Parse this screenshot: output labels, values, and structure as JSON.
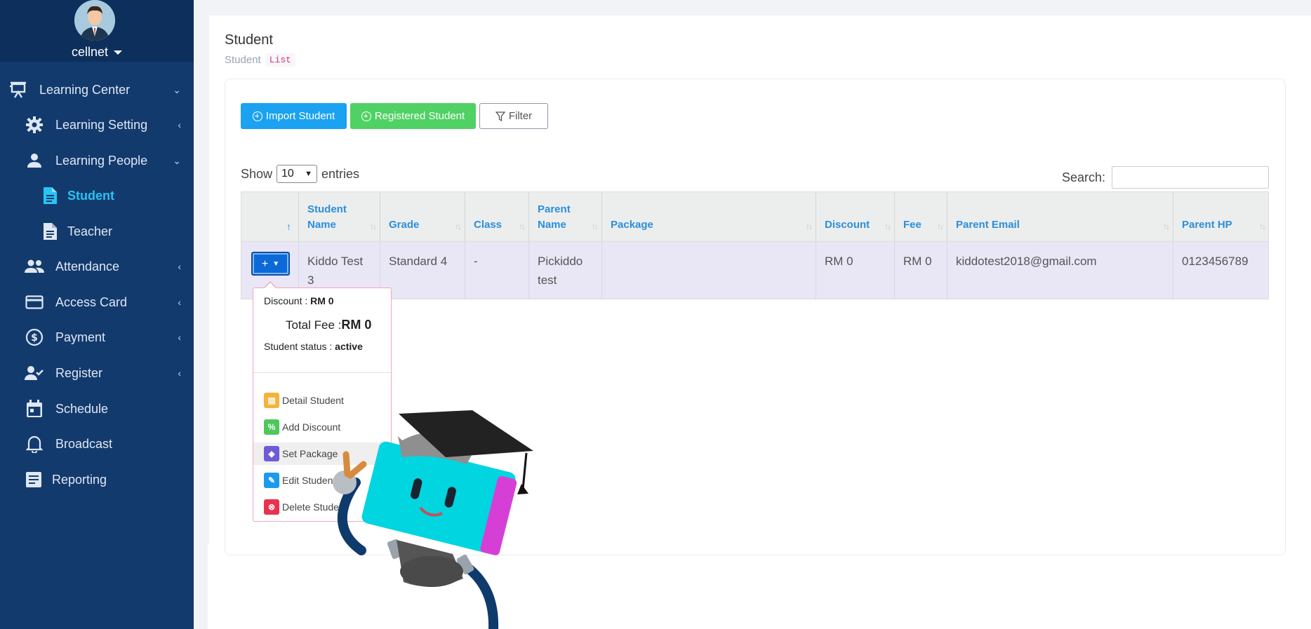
{
  "sidebar": {
    "username": "cellnet",
    "items": [
      {
        "label": "Learning Center",
        "chevron": "⌄"
      },
      {
        "label": "Learning Setting",
        "chevron": "‹"
      },
      {
        "label": "Learning People",
        "chevron": "⌄"
      },
      {
        "label": "Student"
      },
      {
        "label": "Teacher"
      },
      {
        "label": "Attendance",
        "chevron": "‹"
      },
      {
        "label": "Access Card",
        "chevron": "‹"
      },
      {
        "label": "Payment",
        "chevron": "‹"
      },
      {
        "label": "Register",
        "chevron": "‹"
      },
      {
        "label": "Schedule"
      },
      {
        "label": "Broadcast"
      },
      {
        "label": "Reporting"
      }
    ]
  },
  "page": {
    "title": "Student",
    "crumb": "Student",
    "crumb_code": "List"
  },
  "toolbar": {
    "import_label": "Import Student",
    "registered_label": "Registered Student",
    "filter_label": "Filter"
  },
  "table": {
    "show_label": "Show",
    "entries_value": "10",
    "entries_label": "entries",
    "search_label": "Search:",
    "headers": [
      "",
      "Student Name",
      "Grade",
      "Class",
      "Parent Name",
      "Package",
      "Discount",
      "Fee",
      "Parent Email",
      "Parent HP"
    ],
    "row": {
      "student_name": "Kiddo Test 3",
      "grade": "Standard 4",
      "class": "-",
      "parent_name": "Pickiddo test",
      "package": "",
      "discount": "RM 0",
      "fee": "RM 0",
      "parent_email": "kiddotest2018@gmail.com",
      "parent_hp": "0123456789"
    }
  },
  "popover": {
    "discount_label": "Discount : ",
    "discount_value": "RM 0",
    "total_fee_label": "Total Fee :",
    "total_fee_value": "RM 0",
    "status_label": "Student status : ",
    "status_value": "active",
    "menu": [
      "Detail Student",
      "Add Discount",
      "Set Package",
      "Edit Student",
      "Delete Student"
    ]
  },
  "colors": {
    "sidebar": "#123a6d",
    "accent": "#1ba2f0",
    "success": "#4fd163",
    "active_nav": "#28c4f3"
  }
}
